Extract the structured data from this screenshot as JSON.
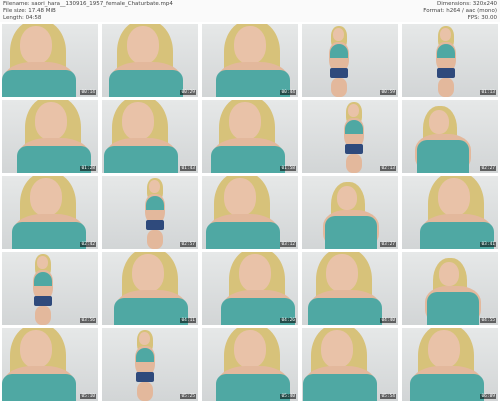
{
  "header": {
    "filename": "Filename: saori_hara__130916_1957_female_Chaturbate.mp4",
    "filesize": "File size: 17.48 MiB",
    "length": "Length: 04:58",
    "dimensions": "Dimensions: 320x240",
    "format": "Format: h264 / aac (mono)",
    "fps": "FPS: 30.00"
  },
  "thumbnails": [
    {
      "timestamp": "00:14",
      "pose": "close"
    },
    {
      "timestamp": "00:29",
      "pose": "close"
    },
    {
      "timestamp": "00:44",
      "pose": "close"
    },
    {
      "timestamp": "00:59",
      "pose": "standing"
    },
    {
      "timestamp": "01:13",
      "pose": "standing"
    },
    {
      "timestamp": "01:28",
      "pose": "close"
    },
    {
      "timestamp": "01:43",
      "pose": "close"
    },
    {
      "timestamp": "01:58",
      "pose": "close"
    },
    {
      "timestamp": "02:13",
      "pose": "standing"
    },
    {
      "timestamp": "02:27",
      "pose": "mid"
    },
    {
      "timestamp": "02:42",
      "pose": "close"
    },
    {
      "timestamp": "02:57",
      "pose": "standing"
    },
    {
      "timestamp": "03:12",
      "pose": "close"
    },
    {
      "timestamp": "03:27",
      "pose": "mid"
    },
    {
      "timestamp": "03:41",
      "pose": "close"
    },
    {
      "timestamp": "03:56",
      "pose": "standing"
    },
    {
      "timestamp": "04:11",
      "pose": "close"
    },
    {
      "timestamp": "04:26",
      "pose": "close"
    },
    {
      "timestamp": "04:40",
      "pose": "close"
    },
    {
      "timestamp": "04:55",
      "pose": "mid"
    },
    {
      "timestamp": "05:10",
      "pose": "close"
    },
    {
      "timestamp": "05:25",
      "pose": "standing"
    },
    {
      "timestamp": "05:40",
      "pose": "close"
    },
    {
      "timestamp": "05:54",
      "pose": "close"
    },
    {
      "timestamp": "06:09",
      "pose": "close"
    }
  ]
}
